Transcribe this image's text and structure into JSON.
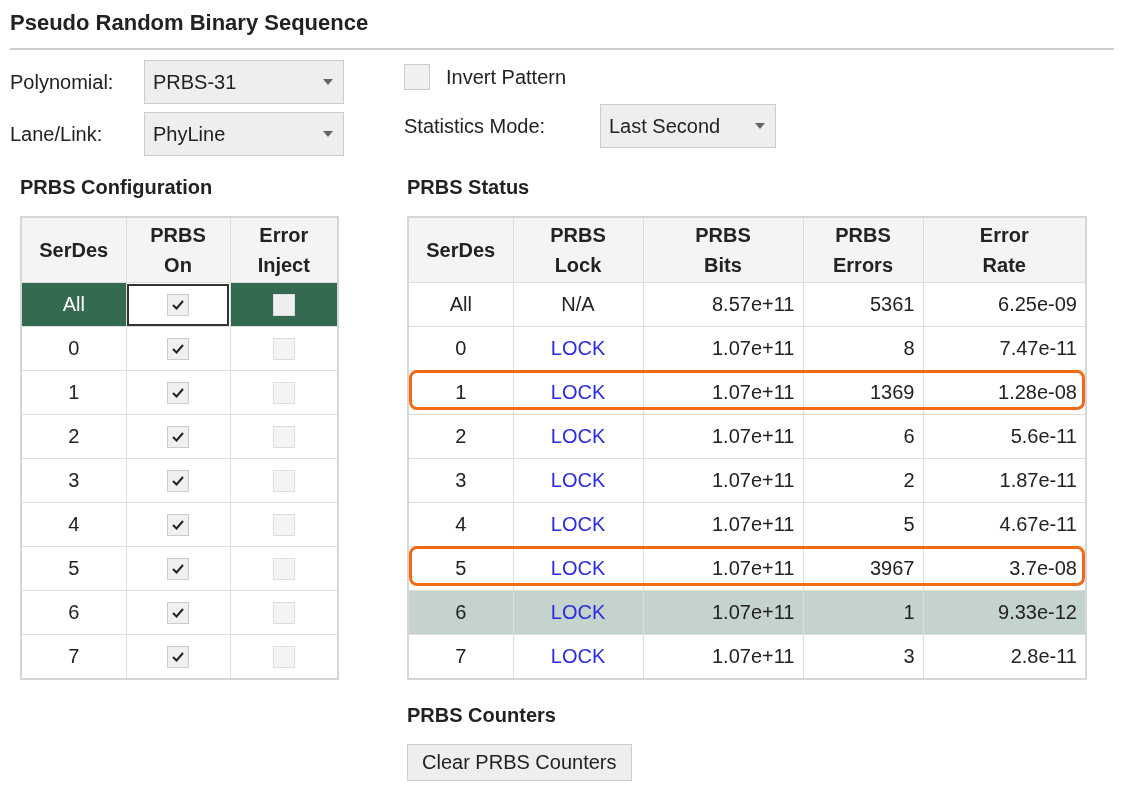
{
  "title": "Pseudo Random Binary Sequence",
  "polynomial": {
    "label": "Polynomial:",
    "value": "PRBS-31"
  },
  "lane_link": {
    "label": "Lane/Link:",
    "value": "PhyLine"
  },
  "invert_pattern": {
    "label": "Invert Pattern",
    "checked": false
  },
  "statistics_mode": {
    "label": "Statistics Mode:",
    "value": "Last Second"
  },
  "config": {
    "title": "PRBS Configuration",
    "columns": [
      "SerDes",
      "PRBS\nOn",
      "Error\nInject"
    ],
    "rows": [
      {
        "serdes": "All",
        "prbs_on": true,
        "error_inject": false,
        "selected": true,
        "focused": true
      },
      {
        "serdes": "0",
        "prbs_on": true,
        "error_inject": false,
        "selected": false,
        "focused": false
      },
      {
        "serdes": "1",
        "prbs_on": true,
        "error_inject": false,
        "selected": false,
        "focused": false
      },
      {
        "serdes": "2",
        "prbs_on": true,
        "error_inject": false,
        "selected": false,
        "focused": false
      },
      {
        "serdes": "3",
        "prbs_on": true,
        "error_inject": false,
        "selected": false,
        "focused": false
      },
      {
        "serdes": "4",
        "prbs_on": true,
        "error_inject": false,
        "selected": false,
        "focused": false
      },
      {
        "serdes": "5",
        "prbs_on": true,
        "error_inject": false,
        "selected": false,
        "focused": false
      },
      {
        "serdes": "6",
        "prbs_on": true,
        "error_inject": false,
        "selected": false,
        "focused": false
      },
      {
        "serdes": "7",
        "prbs_on": true,
        "error_inject": false,
        "selected": false,
        "focused": false
      }
    ]
  },
  "status": {
    "title": "PRBS Status",
    "columns": [
      "SerDes",
      "PRBS\nLock",
      "PRBS\nBits",
      "PRBS\nErrors",
      "Error\nRate"
    ],
    "rows": [
      {
        "serdes": "All",
        "lock": "N/A",
        "locked": false,
        "bits": "8.57e+11",
        "errors": "5361",
        "rate": "6.25e-09",
        "selected": false,
        "highlighted": false
      },
      {
        "serdes": "0",
        "lock": "LOCK",
        "locked": true,
        "bits": "1.07e+11",
        "errors": "8",
        "rate": "7.47e-11",
        "selected": false,
        "highlighted": false
      },
      {
        "serdes": "1",
        "lock": "LOCK",
        "locked": true,
        "bits": "1.07e+11",
        "errors": "1369",
        "rate": "1.28e-08",
        "selected": false,
        "highlighted": true
      },
      {
        "serdes": "2",
        "lock": "LOCK",
        "locked": true,
        "bits": "1.07e+11",
        "errors": "6",
        "rate": "5.6e-11",
        "selected": false,
        "highlighted": false
      },
      {
        "serdes": "3",
        "lock": "LOCK",
        "locked": true,
        "bits": "1.07e+11",
        "errors": "2",
        "rate": "1.87e-11",
        "selected": false,
        "highlighted": false
      },
      {
        "serdes": "4",
        "lock": "LOCK",
        "locked": true,
        "bits": "1.07e+11",
        "errors": "5",
        "rate": "4.67e-11",
        "selected": false,
        "highlighted": false
      },
      {
        "serdes": "5",
        "lock": "LOCK",
        "locked": true,
        "bits": "1.07e+11",
        "errors": "3967",
        "rate": "3.7e-08",
        "selected": false,
        "highlighted": true
      },
      {
        "serdes": "6",
        "lock": "LOCK",
        "locked": true,
        "bits": "1.07e+11",
        "errors": "1",
        "rate": "9.33e-12",
        "selected": true,
        "highlighted": false
      },
      {
        "serdes": "7",
        "lock": "LOCK",
        "locked": true,
        "bits": "1.07e+11",
        "errors": "3",
        "rate": "2.8e-11",
        "selected": false,
        "highlighted": false
      }
    ]
  },
  "counters": {
    "title": "PRBS Counters",
    "button": "Clear PRBS Counters"
  }
}
